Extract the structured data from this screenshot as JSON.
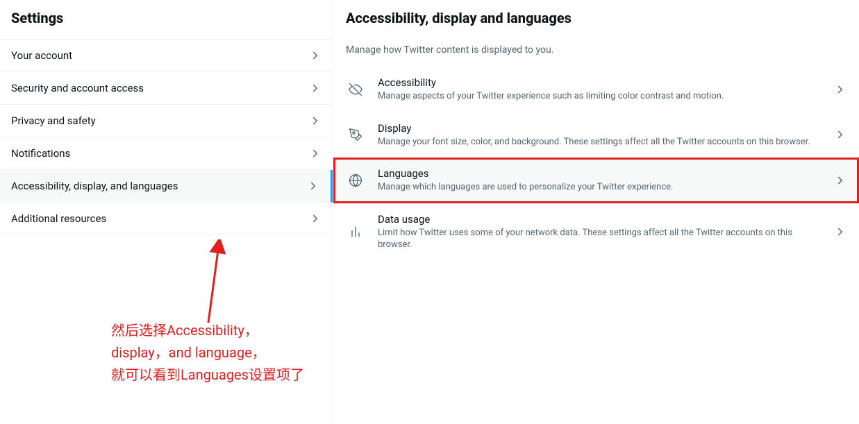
{
  "left": {
    "title": "Settings",
    "items": [
      {
        "label": "Your account"
      },
      {
        "label": "Security and account access"
      },
      {
        "label": "Privacy and safety"
      },
      {
        "label": "Notifications"
      },
      {
        "label": "Accessibility, display, and languages",
        "active": true
      },
      {
        "label": "Additional resources"
      }
    ]
  },
  "right": {
    "title": "Accessibility, display and languages",
    "description": "Manage how Twitter content is displayed to you.",
    "items": [
      {
        "icon": "eye-off-icon",
        "title": "Accessibility",
        "desc": "Manage aspects of your Twitter experience such as limiting color contrast and motion."
      },
      {
        "icon": "brush-icon",
        "title": "Display",
        "desc": "Manage your font size, color, and background. These settings affect all the Twitter accounts on this browser."
      },
      {
        "icon": "globe-icon",
        "title": "Languages",
        "desc": "Manage which languages are used to personalize your Twitter experience.",
        "highlighted": true
      },
      {
        "icon": "bar-chart-icon",
        "title": "Data usage",
        "desc": "Limit how Twitter uses some of your network data. These settings affect all the Twitter accounts on this browser."
      }
    ]
  },
  "annotation": {
    "line1": "然后选择Accessibility，",
    "line2": "display，and language，",
    "line3": "就可以看到Languages设置项了"
  }
}
